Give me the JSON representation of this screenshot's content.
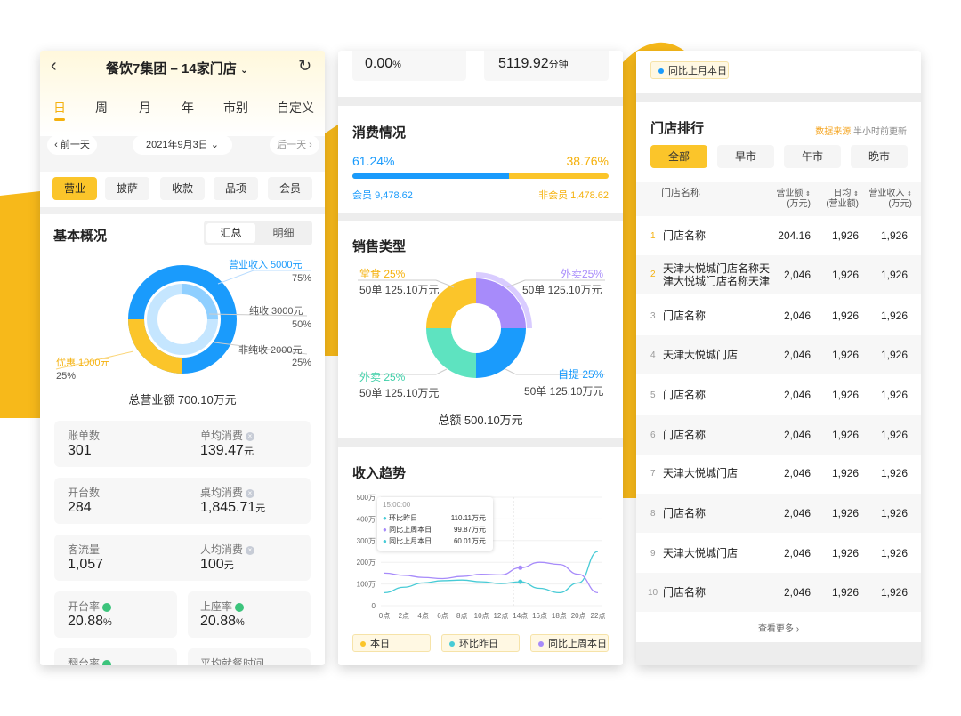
{
  "colors": {
    "accent": "#fbc52a",
    "blue": "#1a9bfc",
    "purple": "#a78bfa",
    "teal": "#5ee3c0",
    "bg_shape": "#f7b91a"
  },
  "panel1": {
    "title": "餐饮7集团 – 14家门店",
    "tabs": [
      "日",
      "周",
      "月",
      "年",
      "市别",
      "自定义"
    ],
    "prev_day": "前一天",
    "date": "2021年9月3日",
    "next_day": "后一天",
    "chips": [
      "营业",
      "披萨",
      "收款",
      "品项",
      "会员"
    ],
    "overview_title": "基本概况",
    "seg": [
      "汇总",
      "明细"
    ],
    "donut": {
      "revenue_label": "营业收入 5000元",
      "revenue_pct": "75%",
      "net_label": "纯收 3000元",
      "net_pct": "50%",
      "nonnet_label": "非纯收 2000元",
      "nonnet_pct": "25%",
      "discount_label": "优惠 1000元",
      "discount_pct": "25%",
      "total": "总营业额 700.10万元"
    },
    "stats": [
      {
        "label": "账单数",
        "value": "301",
        "unit": ""
      },
      {
        "label": "单均消费",
        "value": "139.47",
        "unit": "元"
      },
      {
        "label": "开台数",
        "value": "284",
        "unit": ""
      },
      {
        "label": "桌均消费",
        "value": "1,845.71",
        "unit": "元"
      },
      {
        "label": "客流量",
        "value": "1,057",
        "unit": ""
      },
      {
        "label": "人均消费",
        "value": "100",
        "unit": "元"
      },
      {
        "label": "开台率",
        "value": "20.88",
        "unit": "%"
      },
      {
        "label": "上座率",
        "value": "20.88",
        "unit": "%"
      },
      {
        "label": "翻台率",
        "value": "",
        "unit": ""
      },
      {
        "label": "平均就餐时间",
        "value": "",
        "unit": ""
      }
    ]
  },
  "panel2": {
    "top_value1": "0.00",
    "top_unit1": "%",
    "top_value2": "5119.92",
    "top_unit2": "分钟",
    "consume_title": "消费情况",
    "member_pct": "61.24%",
    "nonmember_pct": "38.76%",
    "member_share": 0.6124,
    "member_label": "会员",
    "member_value": "9,478.62",
    "nonmember_label": "非会员",
    "nonmember_value": "1,478.62",
    "sales_title": "销售类型",
    "sales": [
      {
        "name": "堂食 25%",
        "detail": "50单 125.10万元"
      },
      {
        "name": "外卖25%",
        "detail": "50单 125.10万元"
      },
      {
        "name": "外卖 25%",
        "detail": "50单 125.10万元"
      },
      {
        "name": "自提 25%",
        "detail": "50单 125.10万元"
      }
    ],
    "sales_total": "总额  500.10万元",
    "trend_title": "收入趋势",
    "legend": [
      "本日",
      "环比昨日",
      "同比上周本日"
    ]
  },
  "chart_data": {
    "type": "line",
    "title": "收入趋势",
    "xlabel": "",
    "ylabel": "",
    "categories": [
      "0点",
      "2点",
      "4点",
      "6点",
      "8点",
      "10点",
      "12点",
      "14点",
      "16点",
      "18点",
      "20点",
      "22点"
    ],
    "y_ticks": [
      "0",
      "100万",
      "200万",
      "300万",
      "400万",
      "500万"
    ],
    "ylim": [
      0,
      500
    ],
    "series": [
      {
        "name": "环比昨日",
        "color": "#48cbd6",
        "values": [
          60,
          85,
          105,
          115,
          118,
          110,
          102,
          110,
          80,
          60,
          105,
          250
        ]
      },
      {
        "name": "同比上周本日",
        "color": "#a78bfa",
        "values": [
          150,
          140,
          130,
          125,
          135,
          145,
          142,
          175,
          200,
          190,
          145,
          60
        ]
      },
      {
        "name": "本日",
        "color": "#5ee3c0",
        "values": [
          0,
          0,
          0,
          0,
          0,
          0,
          0,
          0,
          0,
          0,
          0,
          0
        ]
      }
    ],
    "tooltip": {
      "time": "15:00:00",
      "rows": [
        {
          "name": "环比昨日",
          "value": "110.11万元"
        },
        {
          "name": "同比上周本日",
          "value": "99.87万元"
        },
        {
          "name": "同比上月本日",
          "value": "60.01万元"
        }
      ]
    }
  },
  "panel3": {
    "top_legend": "同比上月本日",
    "title": "门店排行",
    "source": "数据来源",
    "update": "半小时前更新",
    "tabs": [
      "全部",
      "早市",
      "午市",
      "晚市"
    ],
    "headers": {
      "name": "门店名称",
      "revenue1": "营业额",
      "revenue2": "(万元)",
      "daily1": "日均",
      "daily2": "(营业额)",
      "income1": "营业收入",
      "income2": "(万元)"
    },
    "rows": [
      {
        "rank": "1",
        "name": "门店名称",
        "v1": "204.16",
        "v2": "1,926",
        "v3": "1,926"
      },
      {
        "rank": "2",
        "name": "天津大悦城门店名称天津大悦城门店名称天津",
        "v1": "2,046",
        "v2": "1,926",
        "v3": "1,926"
      },
      {
        "rank": "3",
        "name": "门店名称",
        "v1": "2,046",
        "v2": "1,926",
        "v3": "1,926"
      },
      {
        "rank": "4",
        "name": "天津大悦城门店",
        "v1": "2,046",
        "v2": "1,926",
        "v3": "1,926"
      },
      {
        "rank": "5",
        "name": "门店名称",
        "v1": "2,046",
        "v2": "1,926",
        "v3": "1,926"
      },
      {
        "rank": "6",
        "name": "门店名称",
        "v1": "2,046",
        "v2": "1,926",
        "v3": "1,926"
      },
      {
        "rank": "7",
        "name": "天津大悦城门店",
        "v1": "2,046",
        "v2": "1,926",
        "v3": "1,926"
      },
      {
        "rank": "8",
        "name": "门店名称",
        "v1": "2,046",
        "v2": "1,926",
        "v3": "1,926"
      },
      {
        "rank": "9",
        "name": "天津大悦城门店",
        "v1": "2,046",
        "v2": "1,926",
        "v3": "1,926"
      },
      {
        "rank": "10",
        "name": "门店名称",
        "v1": "2,046",
        "v2": "1,926",
        "v3": "1,926"
      }
    ],
    "more": "查看更多"
  }
}
